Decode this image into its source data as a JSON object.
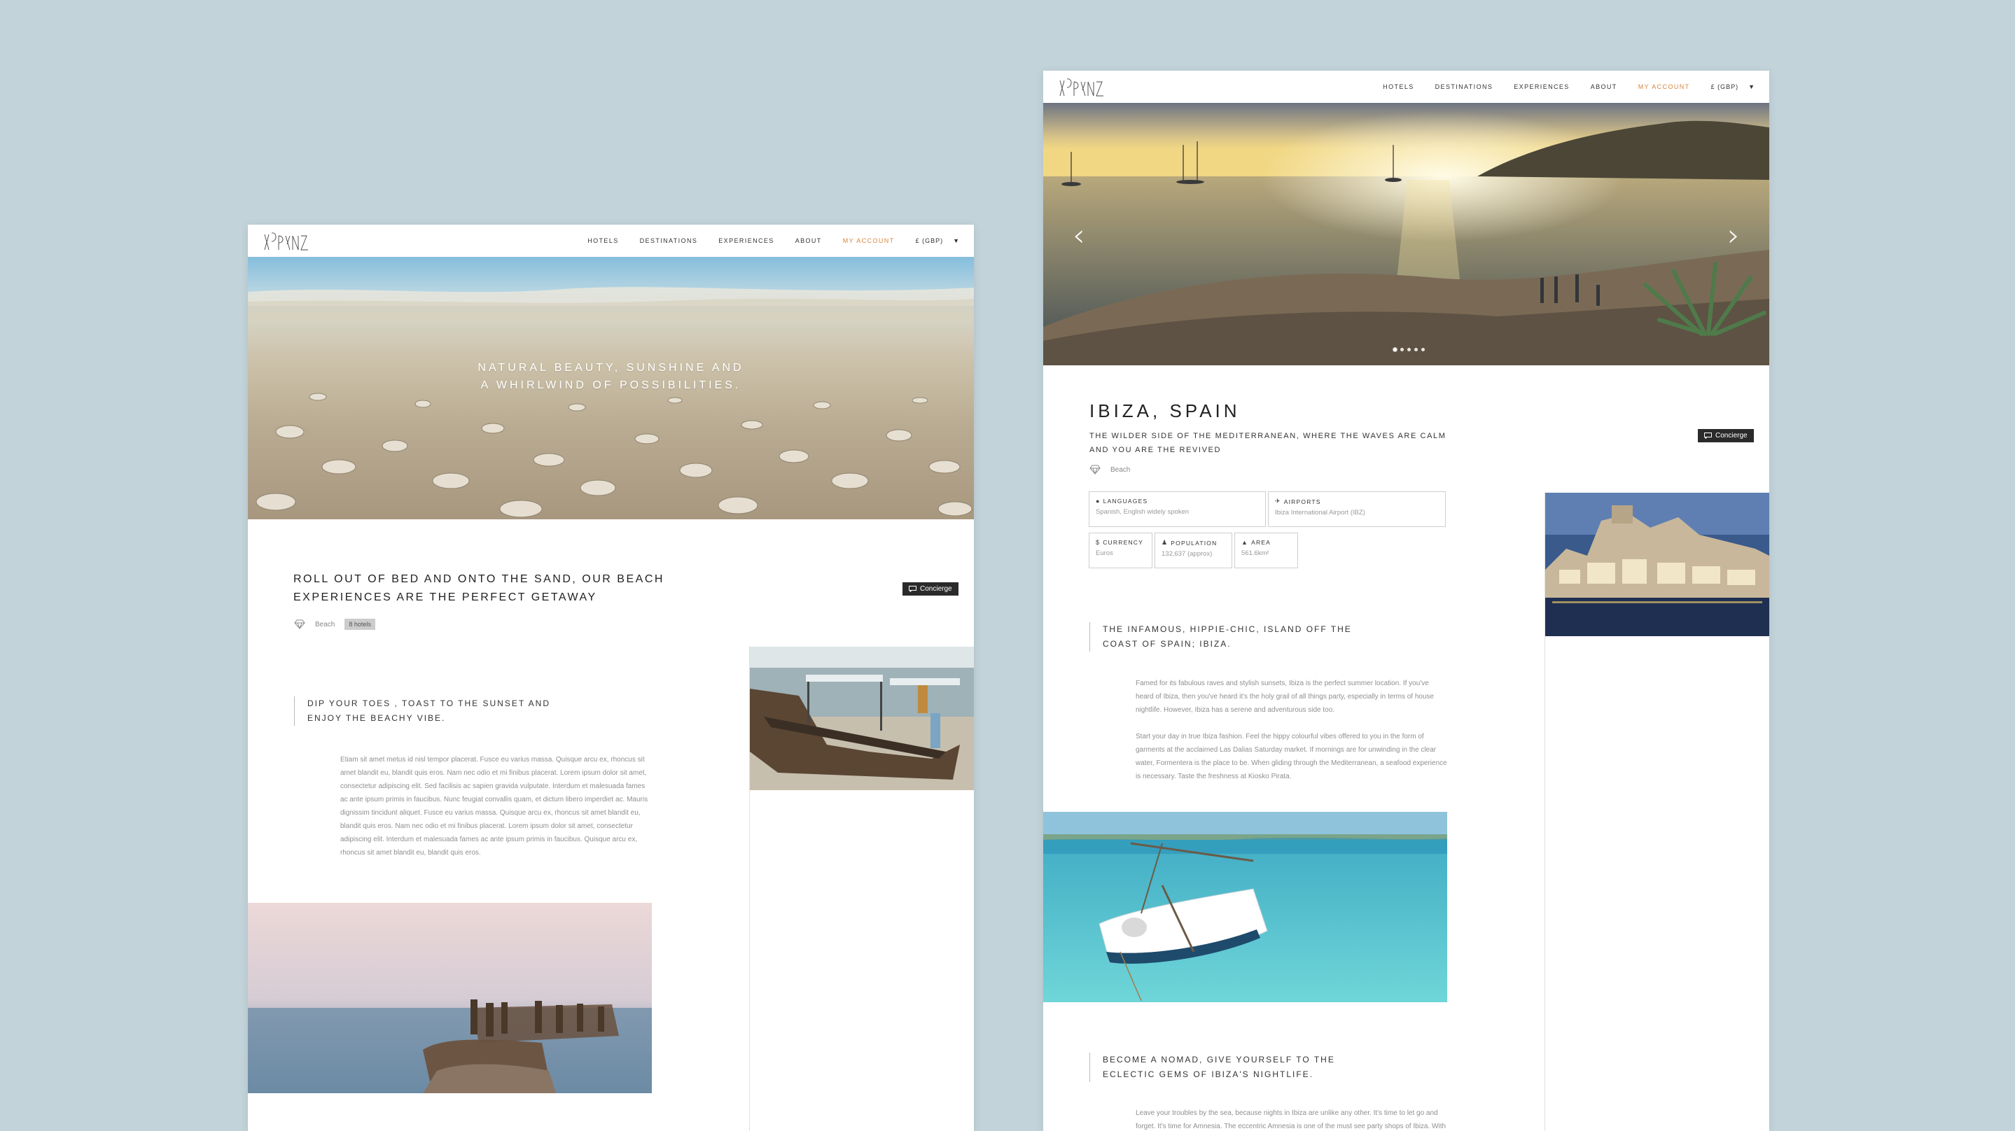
{
  "nav": {
    "items": [
      "HOTELS",
      "DESTINATIONS",
      "EXPERIENCES",
      "ABOUT",
      "MY ACCOUNT"
    ],
    "currency": "£ (GBP)",
    "accent_color": "#d9853b"
  },
  "beach_page": {
    "hero_line1": "NATURAL BEAUTY, SUNSHINE AND",
    "hero_line2": "A WHIRLWIND OF POSSIBILITIES.",
    "title_line1": "ROLL OUT OF BED AND ONTO THE SAND, OUR BEACH",
    "title_line2": "EXPERIENCES ARE THE PERFECT GETAWAY",
    "tag": "Beach",
    "hotels_count": "8 hotels",
    "concierge": "Concierge",
    "quote_line1": "DIP YOUR TOES , TOAST TO THE SUNSET AND",
    "quote_line2": "ENJOY THE BEACHY VIBE.",
    "body_lines": [
      "Etiam sit amet metus id nisl tempor placerat. Fusce eu varius massa. Quisque arcu ex, rhoncus sit",
      "amet blandit eu, blandit quis eros. Nam nec odio et mi finibus placerat. Lorem ipsum dolor sit amet,",
      "consectetur adipiscing elit. Sed facilisis ac sapien gravida vulputate. Interdum et malesuada fames",
      "ac ante ipsum primis in faucibus. Nunc feugiat convallis quam, et dictum libero imperdiet ac. Mauris",
      "dignissim tincidunt aliquet. Fusce eu varius massa. Quisque arcu ex, rhoncus sit amet blandit eu,",
      "blandit quis eros. Nam nec odio et mi finibus placerat. Lorem ipsum dolor sit amet, consectetur",
      "adipiscing elit. Interdum et malesuada fames ac ante ipsum primis in faucibus. Quisque arcu ex,",
      "rhoncus sit amet blandit eu, blandit quis eros."
    ]
  },
  "ibiza_page": {
    "title": "IBIZA, SPAIN",
    "subtitle_line1": "THE WILDER SIDE OF THE MEDITERRANEAN, WHERE THE WAVES ARE CALM",
    "subtitle_line2": "AND YOU ARE THE REVIVED",
    "tag": "Beach",
    "concierge": "Concierge",
    "slider_dots": 5,
    "info": {
      "languages_label": "LANGUAGES",
      "languages_value": "Spanish, English widely spoken",
      "airports_label": "AIRPORTS",
      "airports_value": "Ibiza International Airport (IBZ)",
      "currency_label": "CURRENCY",
      "currency_value": "Euros",
      "population_label": "POPULATION",
      "population_value": "132,637 (approx)",
      "area_label": "AREA",
      "area_value": "561.6km²"
    },
    "quote1_line1": "THE INFAMOUS, HIPPIE-CHIC, ISLAND OFF THE",
    "quote1_line2": "COAST OF SPAIN; IBIZA.",
    "para1": [
      "Famed for its fabulous raves and stylish sunsets, Ibiza is the perfect summer location. If you've",
      "heard of Ibiza, then you've heard it's the holy grail of all things party, especially in terms of house",
      "nightlife. However, Ibiza has a serene and adventurous side too."
    ],
    "para2": [
      "Start your day in true Ibiza fashion. Feel the hippy colourful vibes offered to you in the form of",
      "garments at the acclaimed Las Dalias Saturday market. If mornings are for unwinding in the clear",
      "water, Formentera is the place to be. When gliding through the Mediterranean, a seafood experience",
      "is necessary. Taste the freshness at Kiosko Pirata."
    ],
    "quote2_line1": "BECOME A NOMAD, GIVE YOURSELF TO THE",
    "quote2_line2": "ECLECTIC GEMS OF IBIZA'S NIGHTLIFE.",
    "para3": [
      "Leave your troubles by the sea, because nights in Ibiza are unlike any other. It's time to let go and",
      "forget. It's time for Amnesia. The eccentric Amnesia is one of the must see party shops of Ibiza. With"
    ]
  }
}
